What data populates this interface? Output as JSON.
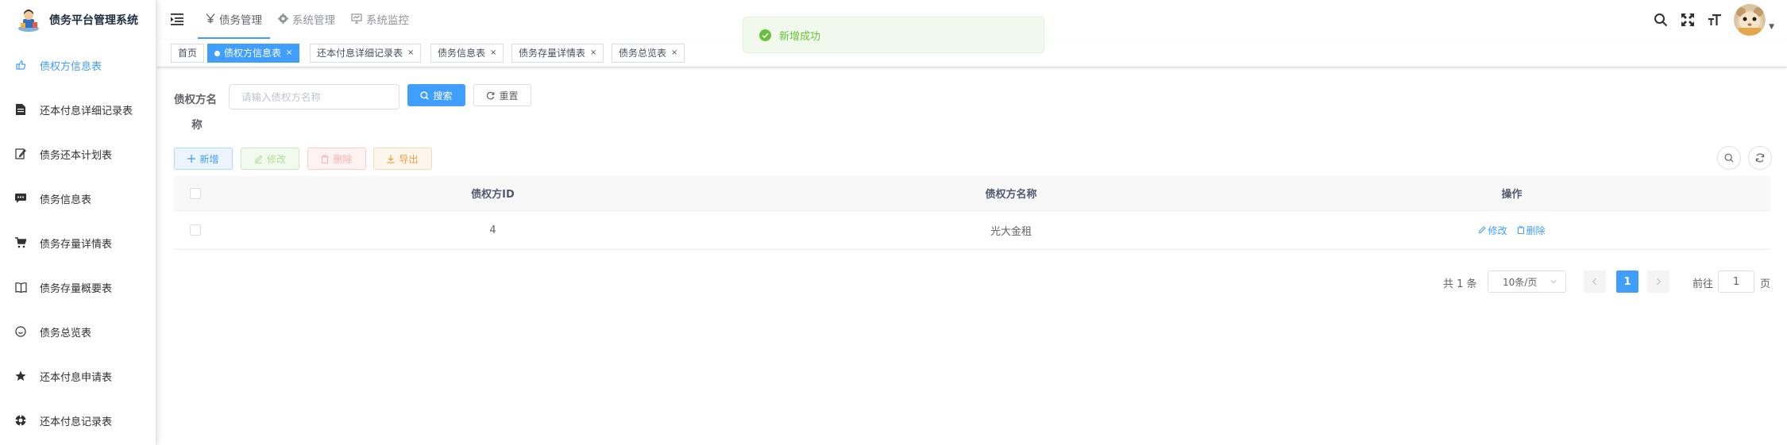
{
  "app": {
    "title": "债务平台管理系统"
  },
  "sidebar": {
    "items": [
      {
        "label": "债权方信息表",
        "icon": "hand-point-icon",
        "active": true
      },
      {
        "label": "还本付息详细记录表",
        "icon": "document-icon"
      },
      {
        "label": "债务还本计划表",
        "icon": "edit-doc-icon"
      },
      {
        "label": "债务信息表",
        "icon": "message-icon"
      },
      {
        "label": "债务存量详情表",
        "icon": "cart-icon"
      },
      {
        "label": "债务存量概要表",
        "icon": "book-icon"
      },
      {
        "label": "债务总览表",
        "icon": "smile-icon"
      },
      {
        "label": "还本付息申请表",
        "icon": "star-icon"
      },
      {
        "label": "还本付息记录表",
        "icon": "lifebuoy-icon"
      }
    ]
  },
  "topnav": {
    "items": [
      {
        "label": "债务管理",
        "icon": "yen-icon",
        "active": true
      },
      {
        "label": "系统管理",
        "icon": "gear-icon"
      },
      {
        "label": "系统监控",
        "icon": "monitor-icon"
      }
    ]
  },
  "tags": [
    {
      "label": "首页"
    },
    {
      "label": "债权方信息表",
      "active": true,
      "close": "×"
    },
    {
      "label": "还本付息详细记录表",
      "close": "×"
    },
    {
      "label": "债务信息表",
      "close": "×"
    },
    {
      "label": "债务存量详情表",
      "close": "×"
    },
    {
      "label": "债务总览表",
      "close": "×"
    }
  ],
  "toast": {
    "message": "新增成功"
  },
  "search": {
    "label_line1": "债权方名",
    "label_line2": "称",
    "placeholder": "请输入债权方名称",
    "search_label": "搜索",
    "reset_label": "重置"
  },
  "toolbar": {
    "add_label": "新增",
    "edit_label": "修改",
    "delete_label": "删除",
    "export_label": "导出"
  },
  "table": {
    "columns": [
      "债权方ID",
      "债权方名称",
      "操作"
    ],
    "rows": [
      {
        "id": "4",
        "name": "光大金租",
        "edit": "修改",
        "delete": "删除"
      }
    ]
  },
  "pagination": {
    "total_text": "共 1 条",
    "page_size": "10条/页",
    "current_page": "1",
    "goto_label": "前往",
    "goto_value": "1",
    "page_suffix": "页"
  },
  "colors": {
    "primary": "#409eff",
    "success": "#67c23a",
    "warning": "#e6a23c",
    "danger": "#f56c6c"
  }
}
